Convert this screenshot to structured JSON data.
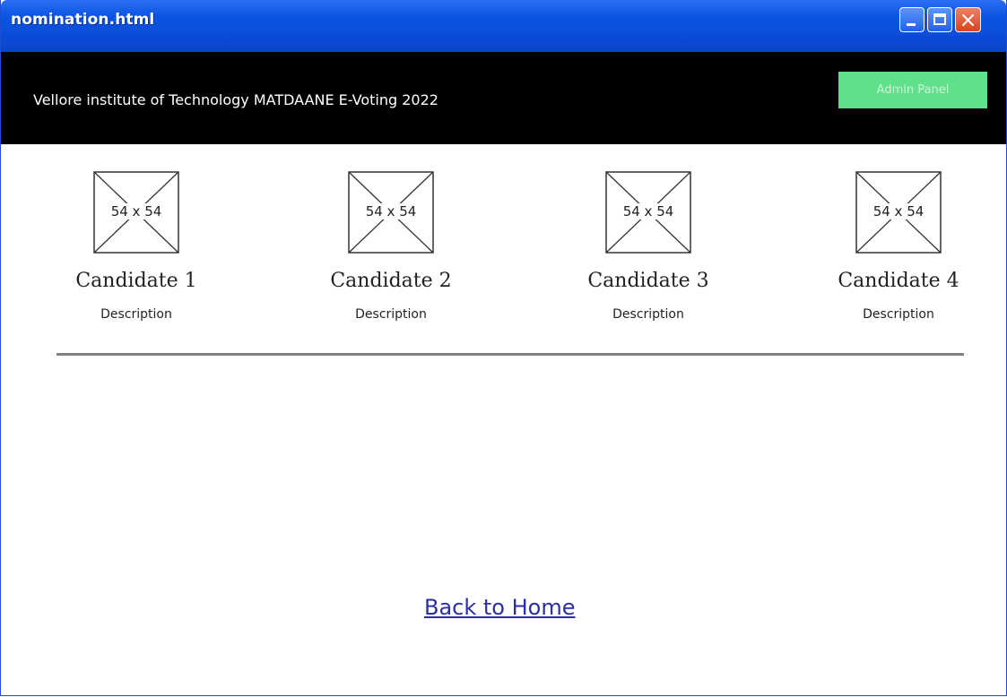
{
  "window": {
    "title": "nomination.html",
    "controls": [
      "minimize-icon",
      "maximize-icon",
      "close-icon"
    ]
  },
  "header": {
    "title": "Vellore institute of Technology MATDAANE E-Voting 2022",
    "admin_button_label": "Admin Panel",
    "background_color": "#000000",
    "admin_button_color": "#5fe08a"
  },
  "candidates": [
    {
      "image_placeholder": "54 x 54",
      "name": "Candidate 1",
      "description": "Description"
    },
    {
      "image_placeholder": "54 x 54",
      "name": "Candidate 2",
      "description": "Description"
    },
    {
      "image_placeholder": "54 x 54",
      "name": "Candidate 3",
      "description": "Description"
    },
    {
      "image_placeholder": "54 x 54",
      "name": "Candidate 4",
      "description": "Description"
    }
  ],
  "footer": {
    "back_link_label": "Back to Home",
    "link_color": "#2b2fa2"
  }
}
